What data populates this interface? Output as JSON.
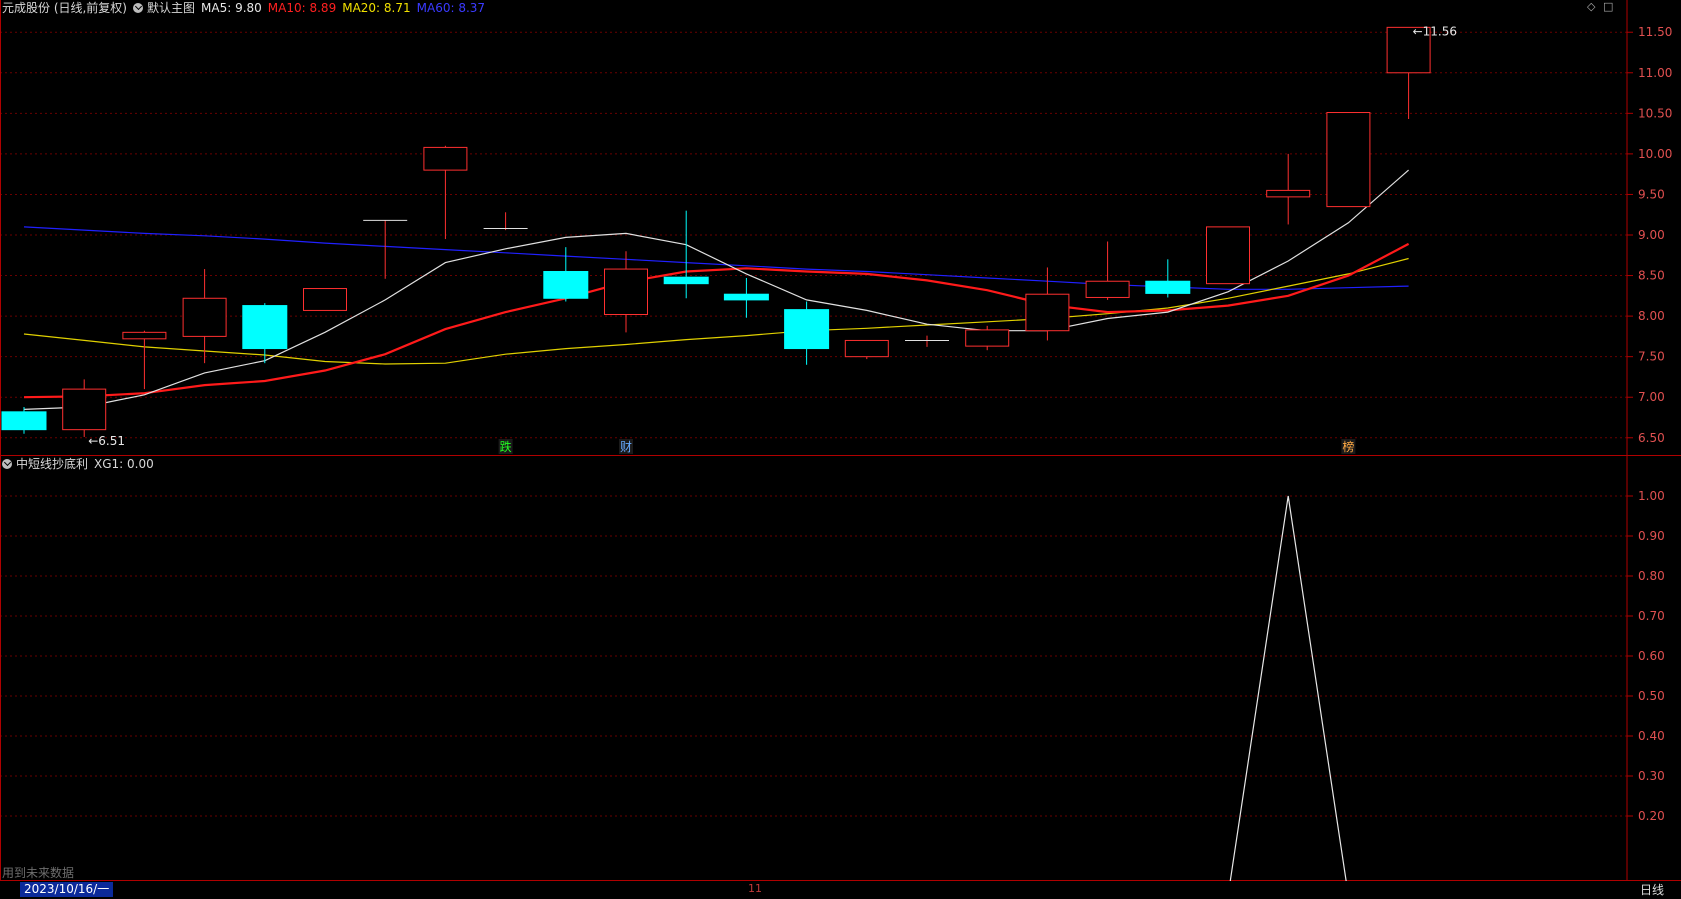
{
  "header": {
    "stock_name": "元成股份 (日线,前复权)",
    "template": "默认主图",
    "ma": [
      {
        "label": "MA5: 9.80",
        "color": "#e6e6e6"
      },
      {
        "label": "MA10: 8.89",
        "color": "#ff2020"
      },
      {
        "label": "MA20: 8.71",
        "color": "#f0e000"
      },
      {
        "label": "MA60: 8.37",
        "color": "#2b2bff"
      }
    ]
  },
  "indicator_header": {
    "name": "中短线抄底利",
    "value": "XG1: 0.00"
  },
  "corner_icons": [
    "diamond-icon",
    "square-icon"
  ],
  "markers": [
    {
      "text": "跌",
      "color": "#22ff22"
    },
    {
      "text": "财",
      "color": "#66aaff"
    },
    {
      "text": "榜",
      "color": "#ffaa44"
    }
  ],
  "annotations": {
    "low": "6.51",
    "high": "11.56"
  },
  "footer": {
    "date": "2023/10/16/一",
    "month_tick": "11",
    "period": "日线",
    "note": "用到未来数据"
  },
  "colors": {
    "up": "#ff3030",
    "down": "#00ffff",
    "axis": "#b00000",
    "grid": "#6a0000",
    "axis_label": "#e05050"
  },
  "chart_data": [
    {
      "type": "candlestick",
      "ylim": [
        6.3,
        11.7
      ],
      "yticks": [
        6.5,
        7.0,
        7.5,
        8.0,
        8.5,
        9.0,
        9.5,
        10.0,
        10.5,
        11.0,
        11.5
      ],
      "candles": [
        {
          "open": 6.82,
          "high": 6.88,
          "low": 6.55,
          "close": 6.6
        },
        {
          "open": 6.6,
          "high": 7.22,
          "low": 6.51,
          "close": 7.1
        },
        {
          "open": 7.72,
          "high": 7.82,
          "low": 7.1,
          "close": 7.8
        },
        {
          "open": 7.75,
          "high": 8.58,
          "low": 7.42,
          "close": 8.22
        },
        {
          "open": 8.13,
          "high": 8.16,
          "low": 7.42,
          "close": 7.6
        },
        {
          "open": 8.07,
          "high": 8.34,
          "low": 8.07,
          "close": 8.34
        },
        {
          "open": 9.18,
          "high": 9.18,
          "low": 8.46,
          "close": 9.18
        },
        {
          "open": 9.8,
          "high": 10.1,
          "low": 8.95,
          "close": 10.08
        },
        {
          "open": 9.08,
          "high": 9.28,
          "low": 9.06,
          "close": 9.08
        },
        {
          "open": 8.55,
          "high": 8.85,
          "low": 8.18,
          "close": 8.22
        },
        {
          "open": 8.02,
          "high": 8.8,
          "low": 7.8,
          "close": 8.58
        },
        {
          "open": 8.48,
          "high": 9.3,
          "low": 8.22,
          "close": 8.4
        },
        {
          "open": 8.27,
          "high": 8.47,
          "low": 7.98,
          "close": 8.2
        },
        {
          "open": 8.08,
          "high": 8.18,
          "low": 7.4,
          "close": 7.6
        },
        {
          "open": 7.5,
          "high": 7.7,
          "low": 7.47,
          "close": 7.7
        },
        {
          "open": 7.7,
          "high": 7.76,
          "low": 7.62,
          "close": 7.7
        },
        {
          "open": 7.63,
          "high": 7.88,
          "low": 7.58,
          "close": 7.83
        },
        {
          "open": 7.82,
          "high": 8.6,
          "low": 7.7,
          "close": 8.27
        },
        {
          "open": 8.23,
          "high": 8.92,
          "low": 8.2,
          "close": 8.43
        },
        {
          "open": 8.43,
          "high": 8.7,
          "low": 8.23,
          "close": 8.28
        },
        {
          "open": 8.4,
          "high": 9.1,
          "low": 8.4,
          "close": 9.1
        },
        {
          "open": 9.47,
          "high": 10.0,
          "low": 9.13,
          "close": 9.55
        },
        {
          "open": 9.35,
          "high": 10.51,
          "low": 9.35,
          "close": 10.51
        },
        {
          "open": 11.0,
          "high": 11.56,
          "low": 10.43,
          "close": 11.56
        }
      ],
      "ma5": [
        6.85,
        6.88,
        7.03,
        7.3,
        7.45,
        7.8,
        8.2,
        8.66,
        8.83,
        8.97,
        9.02,
        8.88,
        8.52,
        8.2,
        8.07,
        7.9,
        7.82,
        7.82,
        7.97,
        8.05,
        8.3,
        8.68,
        9.15,
        9.8
      ],
      "ma10": [
        7.0,
        7.01,
        7.05,
        7.15,
        7.2,
        7.33,
        7.53,
        7.84,
        8.05,
        8.22,
        8.42,
        8.55,
        8.59,
        8.55,
        8.52,
        8.44,
        8.32,
        8.14,
        8.05,
        8.07,
        8.13,
        8.25,
        8.5,
        8.89
      ],
      "ma20": [
        7.78,
        7.7,
        7.62,
        7.57,
        7.52,
        7.44,
        7.41,
        7.42,
        7.53,
        7.6,
        7.65,
        7.71,
        7.76,
        7.82,
        7.85,
        7.89,
        7.93,
        7.97,
        8.03,
        8.1,
        8.22,
        8.37,
        8.52,
        8.71
      ],
      "ma60": [
        9.1,
        9.06,
        9.02,
        8.99,
        8.95,
        8.9,
        8.86,
        8.82,
        8.78,
        8.74,
        8.7,
        8.66,
        8.62,
        8.58,
        8.55,
        8.51,
        8.47,
        8.43,
        8.39,
        8.36,
        8.33,
        8.33,
        8.35,
        8.37
      ]
    },
    {
      "type": "line",
      "title": "中短线抄底利",
      "ylim": [
        0.04,
        1.06
      ],
      "yticks": [
        0.2,
        0.3,
        0.4,
        0.5,
        0.6,
        0.7,
        0.8,
        0.9,
        1.0
      ],
      "series": [
        {
          "name": "XG1",
          "values": [
            0,
            0,
            0,
            0,
            0,
            0,
            0,
            0,
            0,
            0,
            0,
            0,
            0,
            0,
            0,
            0,
            0,
            0,
            0,
            0,
            0,
            1,
            0,
            0
          ]
        }
      ]
    }
  ]
}
